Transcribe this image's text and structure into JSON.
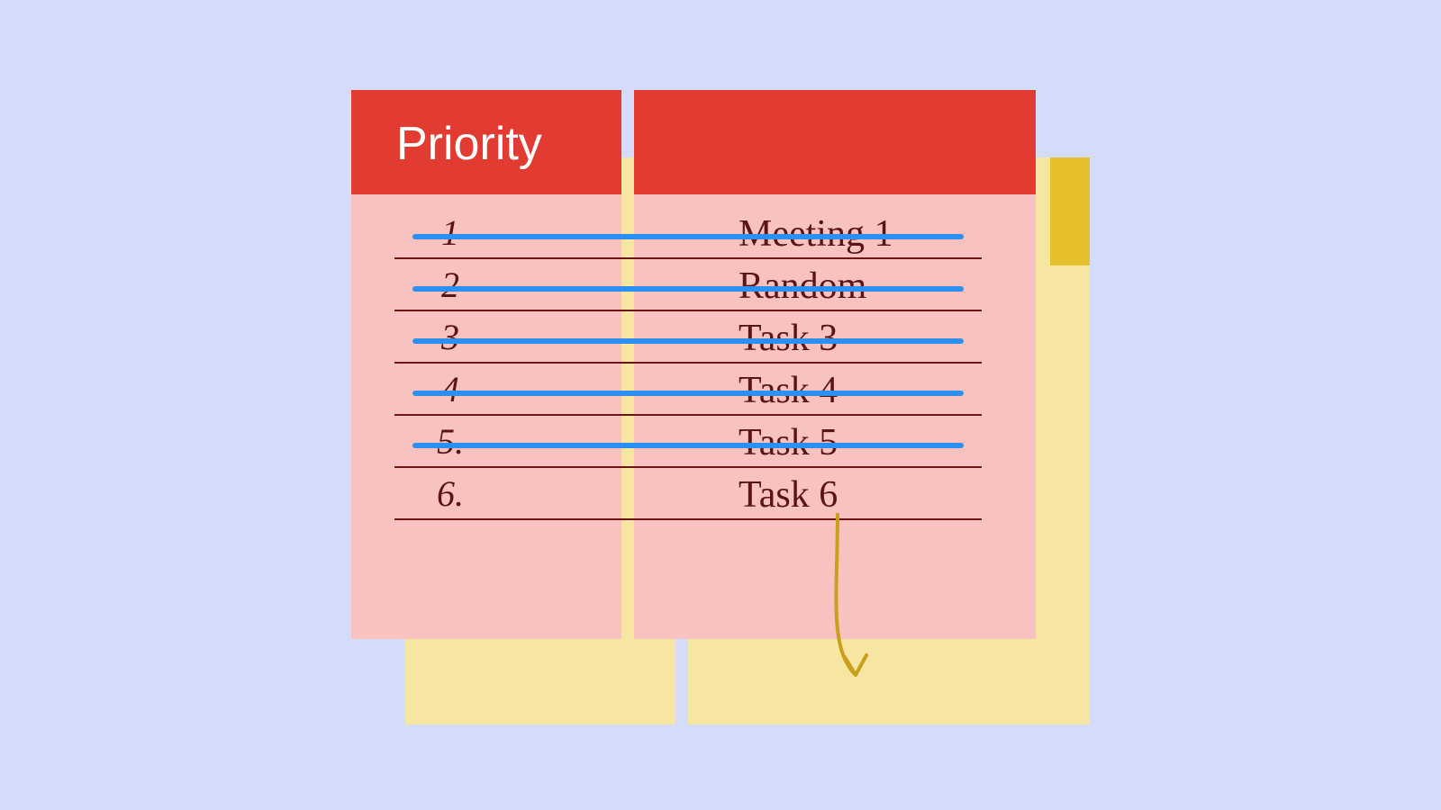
{
  "card": {
    "title": "Priority",
    "rows": [
      {
        "n": "1",
        "label": "Meeting 1",
        "done": true
      },
      {
        "n": "2",
        "label": "Random",
        "done": true
      },
      {
        "n": "3",
        "label": "Task 3",
        "done": true
      },
      {
        "n": "4",
        "label": "Task 4",
        "done": true
      },
      {
        "n": "5.",
        "label": "Task 5",
        "done": true
      },
      {
        "n": "6.",
        "label": "Task 6",
        "done": false
      }
    ]
  },
  "colors": {
    "page_bg": "#d5dcfa",
    "card_header": "#e13b32",
    "card_body": "#f7c2c0",
    "back_card": "#f6e6a2",
    "back_tab": "#e6c02c",
    "ink": "#5b1313",
    "strike": "#2d8ff0",
    "arrow": "#c99f1b"
  }
}
